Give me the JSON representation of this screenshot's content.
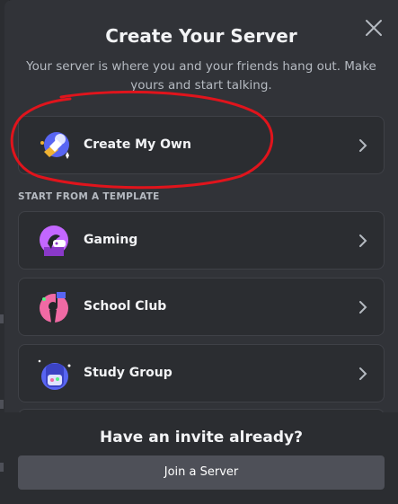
{
  "dialog": {
    "title": "Create Your Server",
    "subtitle": "Your server is where you and your friends hang out. Make yours and start talking."
  },
  "options": {
    "create_own": {
      "label": "Create My Own",
      "icon": "create-server-icon"
    },
    "section_header": "START FROM A TEMPLATE",
    "templates": [
      {
        "label": "Gaming",
        "icon": "gaming-icon"
      },
      {
        "label": "School Club",
        "icon": "school-club-icon"
      },
      {
        "label": "Study Group",
        "icon": "study-group-icon"
      }
    ]
  },
  "footer": {
    "title": "Have an invite already?",
    "join_button": "Join a Server"
  },
  "colors": {
    "modal_bg": "#313338",
    "card_bg": "#2b2d31",
    "annotation_red": "#e0141c"
  }
}
